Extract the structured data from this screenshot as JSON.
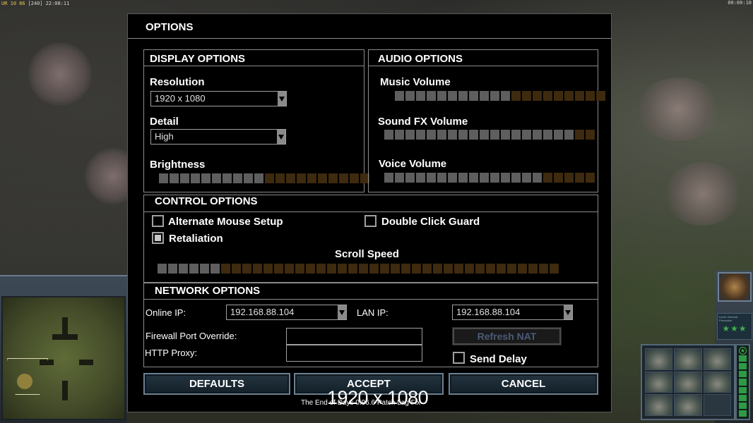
{
  "hud": {
    "top_left_a": "UR 10",
    "top_left_b": "86",
    "top_left_c": "[240]",
    "top_left_time": "22:08:11",
    "top_right_time": "00:00:10"
  },
  "options": {
    "title": "OPTIONS",
    "display": {
      "header": "DISPLAY OPTIONS",
      "resolution_label": "Resolution",
      "resolution_value": "1920 x 1080",
      "detail_label": "Detail",
      "detail_value": "High",
      "brightness_label": "Brightness",
      "brightness_level": 10,
      "brightness_total": 20
    },
    "audio": {
      "header": "AUDIO OPTIONS",
      "music_label": "Music Volume",
      "music_level": 11,
      "music_total": 20,
      "sfx_label": "Sound FX Volume",
      "sfx_level": 18,
      "sfx_total": 20,
      "voice_label": "Voice Volume",
      "voice_level": 15,
      "voice_total": 20
    },
    "control": {
      "header": "CONTROL OPTIONS",
      "alt_mouse_label": "Alternate Mouse Setup",
      "alt_mouse_checked": false,
      "double_click_label": "Double Click Guard",
      "double_click_checked": false,
      "retaliation_label": "Retaliation",
      "retaliation_checked": true,
      "scroll_speed_label": "Scroll Speed",
      "scroll_level": 6,
      "scroll_total": 38
    },
    "network": {
      "header": "NETWORK OPTIONS",
      "online_ip_label": "Online IP:",
      "online_ip_value": "192.168.88.104",
      "lan_ip_label": "LAN IP:",
      "lan_ip_value": "192.168.88.104",
      "firewall_label": "Firewall Port Override:",
      "firewall_value": "",
      "http_proxy_label": "HTTP Proxy:",
      "http_proxy_value": "",
      "refresh_nat_label": "Refresh NAT",
      "send_delay_label": "Send Delay",
      "send_delay_checked": false
    },
    "buttons": {
      "defaults": "DEFAULTS",
      "accept": "ACCEPT",
      "cancel": "CANCEL"
    },
    "footer_text": "The End of Days 0.96.6 Patch Lag Fix",
    "resolution_watermark": "1920 x 1080"
  },
  "colors": {
    "slider_on": "#5e5e5e",
    "slider_off": "#3e2a0e",
    "rank_stars": "#3eb04a"
  },
  "command_bar": {
    "rank_text": "Level: General Promotion",
    "rank_stars": "★★★"
  }
}
